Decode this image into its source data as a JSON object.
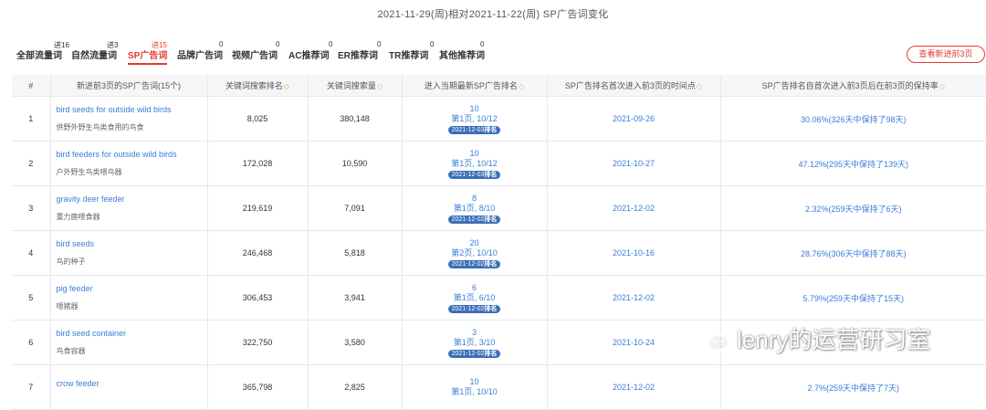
{
  "page_title": "2021-11-29(周)相对2021-11-22(周) SP广告词变化",
  "tabs": [
    {
      "label": "全部流量词",
      "badge": "进16",
      "active": false
    },
    {
      "label": "自然流量词",
      "badge": "进3",
      "active": false
    },
    {
      "label": "SP广告词",
      "badge": "进15",
      "active": true
    },
    {
      "label": "品牌广告词",
      "badge": "0",
      "active": false
    },
    {
      "label": "视频广告词",
      "badge": "0",
      "active": false
    },
    {
      "label": "AC推荐词",
      "badge": "0",
      "active": false
    },
    {
      "label": "ER推荐词",
      "badge": "0",
      "active": false
    },
    {
      "label": "TR推荐词",
      "badge": "0",
      "active": false
    },
    {
      "label": "其他推荐词",
      "badge": "0",
      "active": false
    }
  ],
  "view_new_button": "查看新进前3页",
  "table": {
    "headers": [
      "#",
      "新进前3页的SP广告词(15个)",
      "关键词搜索排名",
      "关键词搜索量",
      "进入当期最新SP广告排名",
      "SP广告排名首次进入前3页的时间点",
      "SP广告排名自首次进入前3页后在前3页的保持率"
    ],
    "rows": [
      {
        "index": "1",
        "keyword_en": "bird seeds for outside wild birds",
        "keyword_cn": "供野外野生鸟类食用的鸟食",
        "search_rank": "8,025",
        "search_volume": "380,148",
        "rank_num": "10",
        "rank_page": "第1页, 10/12",
        "rank_date": "2021-12-03",
        "rank_tag": "排名",
        "first_time": "2021-09-26",
        "retention": "30.06%(326天中保持了98天)"
      },
      {
        "index": "2",
        "keyword_en": "bird feeders for outside wild birds",
        "keyword_cn": "户外野生鸟类喂鸟器",
        "search_rank": "172,028",
        "search_volume": "10,590",
        "rank_num": "10",
        "rank_page": "第1页, 10/12",
        "rank_date": "2021-12-03",
        "rank_tag": "排名",
        "first_time": "2021-10-27",
        "retention": "47.12%(295天中保持了139天)"
      },
      {
        "index": "3",
        "keyword_en": "gravity deer feeder",
        "keyword_cn": "重力鹿喂食器",
        "search_rank": "219,619",
        "search_volume": "7,091",
        "rank_num": "8",
        "rank_page": "第1页, 8/10",
        "rank_date": "2021-12-02",
        "rank_tag": "排名",
        "first_time": "2021-12-02",
        "retention": "2.32%(259天中保持了6天)"
      },
      {
        "index": "4",
        "keyword_en": "bird seeds",
        "keyword_cn": "鸟的种子",
        "search_rank": "246,468",
        "search_volume": "5,818",
        "rank_num": "20",
        "rank_page": "第2页, 10/10",
        "rank_date": "2021-12-02",
        "rank_tag": "排名",
        "first_time": "2021-10-16",
        "retention": "28.76%(306天中保持了88天)"
      },
      {
        "index": "5",
        "keyword_en": "pig feeder",
        "keyword_cn": "喂猪器",
        "search_rank": "306,453",
        "search_volume": "3,941",
        "rank_num": "6",
        "rank_page": "第1页, 6/10",
        "rank_date": "2021-12-02",
        "rank_tag": "排名",
        "first_time": "2021-12-02",
        "retention": "5.79%(259天中保持了15天)"
      },
      {
        "index": "6",
        "keyword_en": "bird seed container",
        "keyword_cn": "鸟食容器",
        "search_rank": "322,750",
        "search_volume": "3,580",
        "rank_num": "3",
        "rank_page": "第1页, 3/10",
        "rank_date": "2021-12-02",
        "rank_tag": "排名",
        "first_time": "2021-10-24",
        "retention": ""
      },
      {
        "index": "7",
        "keyword_en": "crow feeder",
        "keyword_cn": "",
        "search_rank": "365,798",
        "search_volume": "2,825",
        "rank_num": "10",
        "rank_page": "第1页, 10/10",
        "rank_date": "",
        "rank_tag": "",
        "first_time": "2021-12-02",
        "retention": "2.7%(259天中保持了7天)"
      }
    ]
  },
  "watermark": "lenry的运营研习室"
}
